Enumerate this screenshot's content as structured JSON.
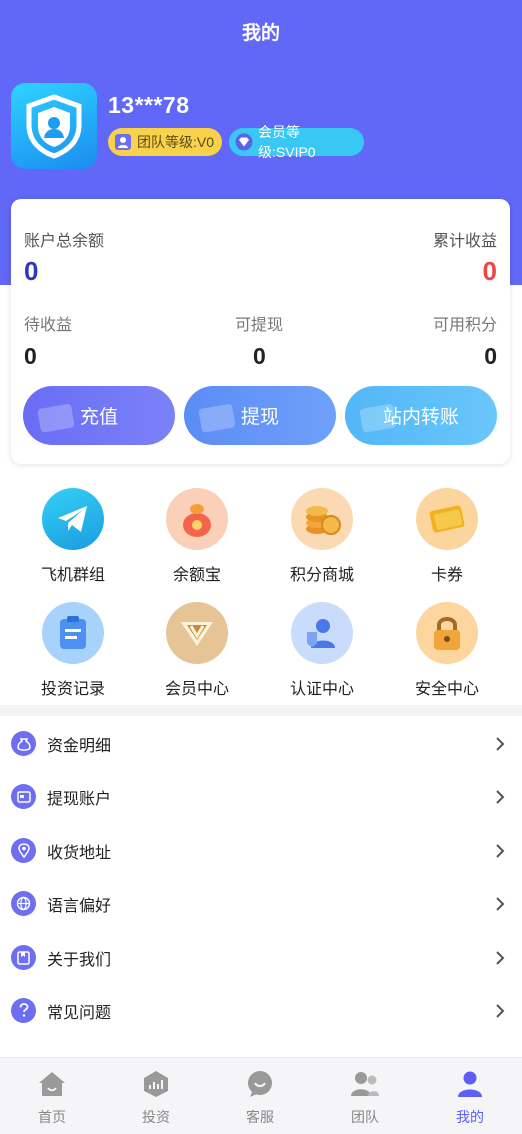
{
  "header": {
    "title": "我的"
  },
  "user": {
    "name": "13***78",
    "team_level": "团队等级:V0",
    "vip_level": "会员等级:SVIP0"
  },
  "balance": {
    "total_label": "账户总余额",
    "total_value": "0",
    "earnings_label": "累计收益",
    "earnings_value": "0",
    "pending_label": "待收益",
    "pending_value": "0",
    "withdrawable_label": "可提现",
    "withdrawable_value": "0",
    "points_label": "可用积分",
    "points_value": "0"
  },
  "actions": {
    "recharge": "充值",
    "withdraw": "提现",
    "transfer": "站内转账"
  },
  "grid": [
    {
      "label": "飞机群组",
      "icon": "telegram-icon"
    },
    {
      "label": "余额宝",
      "icon": "money-bag-icon"
    },
    {
      "label": "积分商城",
      "icon": "coins-icon"
    },
    {
      "label": "卡券",
      "icon": "ticket-icon"
    },
    {
      "label": "投资记录",
      "icon": "clipboard-icon"
    },
    {
      "label": "会员中心",
      "icon": "vip-crown-icon"
    },
    {
      "label": "认证中心",
      "icon": "verified-user-icon"
    },
    {
      "label": "安全中心",
      "icon": "padlock-icon"
    }
  ],
  "menu": [
    {
      "label": "资金明细",
      "icon": "money-bag-icon"
    },
    {
      "label": "提现账户",
      "icon": "card-icon"
    },
    {
      "label": "收货地址",
      "icon": "location-icon"
    },
    {
      "label": "语言偏好",
      "icon": "globe-icon"
    },
    {
      "label": "关于我们",
      "icon": "book-icon"
    },
    {
      "label": "常见问题",
      "icon": "question-icon"
    }
  ],
  "tabs": [
    {
      "label": "首页",
      "icon": "home-icon"
    },
    {
      "label": "投资",
      "icon": "invest-icon"
    },
    {
      "label": "客服",
      "icon": "chat-icon"
    },
    {
      "label": "团队",
      "icon": "team-icon"
    },
    {
      "label": "我的",
      "icon": "profile-icon"
    }
  ],
  "colors": {
    "primary": "#6167f6",
    "earnings": "#f04444",
    "total": "#2d3ab8",
    "active_tab": "#5b5ff2"
  }
}
